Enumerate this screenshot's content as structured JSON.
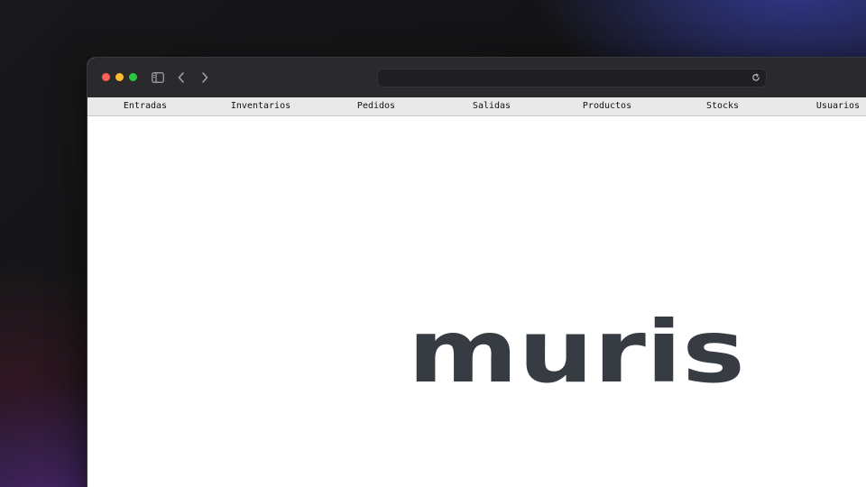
{
  "browser": {
    "address": "",
    "icons": {
      "sidebar": "sidebar-icon",
      "back": "chevron-left-icon",
      "forward": "chevron-right-icon",
      "reload": "reload-icon"
    }
  },
  "nav": {
    "items": [
      {
        "label": "Entradas"
      },
      {
        "label": "Inventarios"
      },
      {
        "label": "Pedidos"
      },
      {
        "label": "Salidas"
      },
      {
        "label": "Productos"
      },
      {
        "label": "Stocks"
      },
      {
        "label": "Usuarios"
      }
    ]
  },
  "main": {
    "logo_text": "muris",
    "logo_color": "#373c43"
  }
}
